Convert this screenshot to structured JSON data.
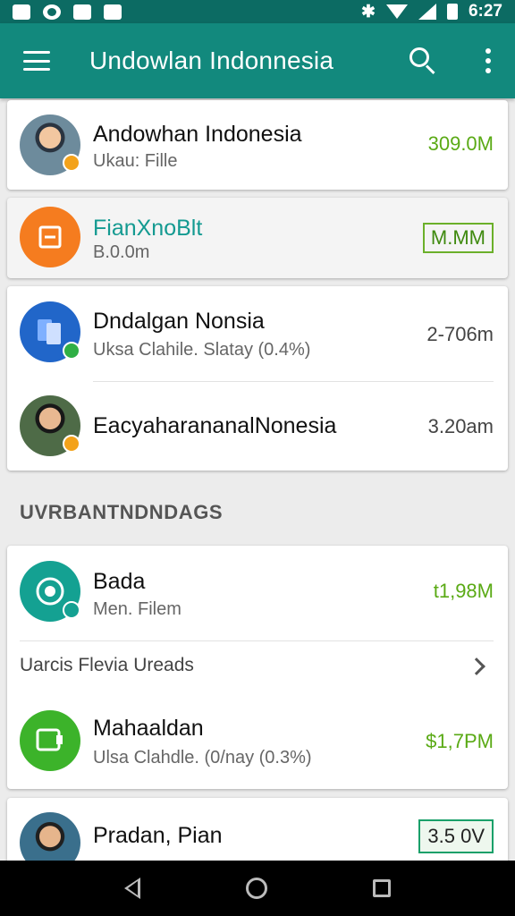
{
  "status_bar": {
    "icons": [
      "mail-icon",
      "circle-icon",
      "image-icon",
      "camera-icon"
    ],
    "time": "6:27"
  },
  "app_bar": {
    "title": "Undowlan Indonnesia"
  },
  "card_top": {
    "name": "Andowhan Indonesia",
    "subtitle": "Ukau: Fille",
    "amount": "309.0M"
  },
  "card_second": {
    "name": "FianXnoBlt",
    "subtitle": "B.0.0m",
    "amount": "M.MM"
  },
  "card_group1": {
    "rows": [
      {
        "name": "Dndalgan Nonsia",
        "subtitle": "Uksa Clahile. Slatay (0.4%)",
        "amount": "2-706m"
      },
      {
        "name": "EacyaharananalNonesia",
        "subtitle": "",
        "amount": "3.20am"
      }
    ]
  },
  "section_header": "UVRBANTNDNDAGS",
  "card_group2": {
    "row1": {
      "name": "Bada",
      "subtitle": "Men. Filem",
      "amount": "t1,98M"
    },
    "link_label": "Uarcis Flevia Ureads",
    "row2": {
      "name": "Mahaaldan",
      "subtitle": "Ulsa Clahdle. (0/nay (0.3%)",
      "amount": "$1,7PM"
    }
  },
  "card_bottom": {
    "name": "Pradan, Pian",
    "subtitle": "",
    "amount": "3.5 0V"
  },
  "colors": {
    "app_bar": "#12897d",
    "status_bar": "#0c6b63",
    "amount_green": "#5aaa15"
  }
}
